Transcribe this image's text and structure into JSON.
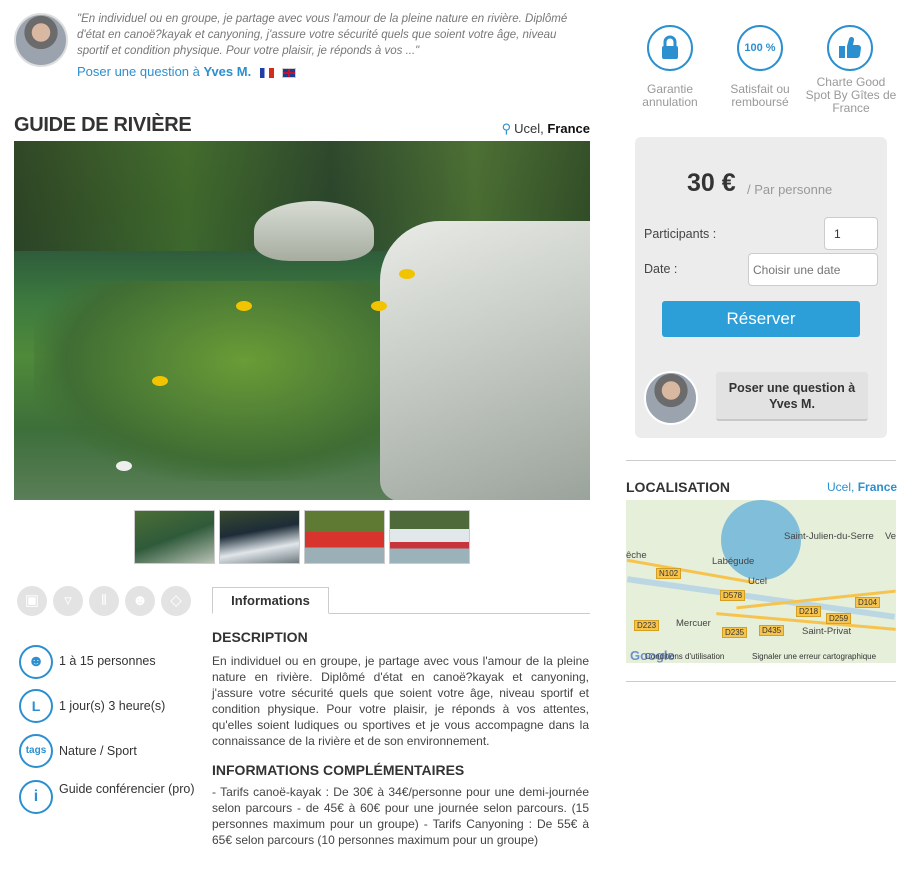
{
  "header": {
    "quote": "\"En individuel ou en groupe, je partage avec vous l'amour de la pleine nature en rivière. Diplômé d'état en canoë?kayak et canyoning, j'assure votre sécurité quels que soient votre âge, niveau sportif et condition physique. Pour votre plaisir, je réponds à vos ...\"",
    "ask_prefix": "Poser une question à",
    "guide_name": "Yves M."
  },
  "title": "GUIDE DE RIVIÈRE",
  "location": {
    "city": "Ucel,",
    "country": "France"
  },
  "badges": [
    {
      "icon": "lock-icon",
      "label": "Garantie annulation"
    },
    {
      "icon": "100-percent-icon",
      "text": "100 %",
      "label": "Satisfait ou remboursé"
    },
    {
      "icon": "thumbs-up-icon",
      "label": "Charte Good Spot By Gîtes de France"
    }
  ],
  "booking": {
    "price": "30 €",
    "per": "/ Par personne",
    "participants_label": "Participants :",
    "participants_value": "1",
    "date_label": "Date :",
    "date_placeholder": "Choisir une date",
    "reserve_label": "Réserver",
    "ask_label": "Poser une question à Yves M."
  },
  "features": [
    {
      "icon": "group-icon",
      "text": "1 à 15 personnes"
    },
    {
      "icon": "duration-icon",
      "glyph": "L",
      "text": "1 jour(s) 3 heure(s)"
    },
    {
      "icon": "tags-icon",
      "glyph": "tags",
      "text": "Nature / Sport"
    },
    {
      "icon": "info-icon",
      "glyph": "i",
      "text": "Guide conférencier (pro)"
    }
  ],
  "tab_label": "Informations",
  "description": {
    "heading": "DESCRIPTION",
    "body": "En individuel ou en groupe, je partage avec vous l'amour de la pleine nature en rivière. Diplômé d'état en canoë?kayak et canyoning, j'assure votre sécurité quels que soient votre âge, niveau sportif et condition physique. Pour votre plaisir, je réponds à vos attentes, qu'elles soient ludiques ou sportives et je vous accompagne dans la connaissance de la rivière et de son environnement."
  },
  "more_info": {
    "heading": "INFORMATIONS COMPLÉMENTAIRES",
    "body": "- Tarifs canoë-kayak : De 30€ à 34€/personne pour une demi-journée selon parcours - de 45€ à 60€ pour une journée selon parcours. (15 personnes maximum pour un groupe) - Tarifs Canyoning : De 55€ à 65€ selon parcours (10 personnes maximum pour un groupe)"
  },
  "localisation": {
    "title": "LOCALISATION",
    "city": "Ucel,",
    "country": "France",
    "map_places": [
      "Saint-Julien-du-Serre",
      "Labégude",
      "Ucel",
      "Mercuer",
      "Saint-Privat",
      "êche",
      "Ve"
    ],
    "map_roads": [
      "N102",
      "D578",
      "D218",
      "D259",
      "D104",
      "D223",
      "D435",
      "D235"
    ],
    "map_footer": [
      "Conditions d'utilisation",
      "Signaler une erreur cartographique"
    ],
    "google": "Google"
  },
  "colors": {
    "accent": "#2c8fcf",
    "button": "#2c9fd9",
    "box_bg": "#ececec"
  }
}
